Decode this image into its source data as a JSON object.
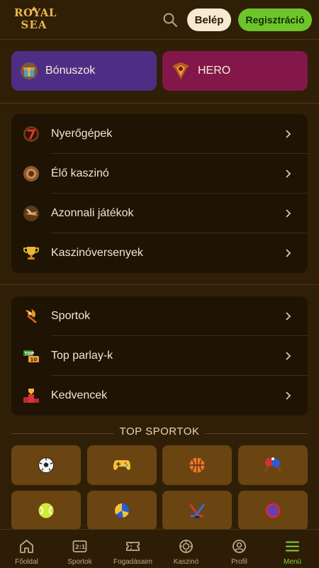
{
  "header": {
    "logo_line1": "ROYAL",
    "logo_line2": "SEA",
    "login_label": "Belép",
    "register_label": "Regisztráció",
    "search_icon": "search-icon"
  },
  "promos": [
    {
      "label": "Bónuszok",
      "icon": "gift-icon",
      "color": "#4e2e84"
    },
    {
      "label": "HERO",
      "icon": "hero-shield-icon",
      "color": "#83174a"
    }
  ],
  "casino_menu": [
    {
      "label": "Nyerőgépek",
      "icon": "slot-seven-icon"
    },
    {
      "label": "Élő kaszinó",
      "icon": "live-casino-chip-icon"
    },
    {
      "label": "Azonnali játékok",
      "icon": "plane-icon"
    },
    {
      "label": "Kaszinóversenyek",
      "icon": "trophy-icon"
    }
  ],
  "sports_menu": [
    {
      "label": "Sportok",
      "icon": "torch-icon"
    },
    {
      "label": "Top parlay-k",
      "icon": "top-10-icon"
    },
    {
      "label": "Kedvencek",
      "icon": "podium-icon"
    }
  ],
  "top_sports": {
    "title": "TOP SPORTOK",
    "items": [
      "football-icon",
      "gamepad-icon",
      "basketball-icon",
      "table-tennis-icon",
      "tennis-icon",
      "volleyball-icon",
      "hockey-icon",
      "mma-glove-icon"
    ]
  },
  "nav": [
    {
      "label": "Főoldal",
      "icon": "home-icon",
      "active": false
    },
    {
      "label": "Sportok",
      "icon": "scoreboard-icon",
      "active": false
    },
    {
      "label": "Fogadásaim",
      "icon": "ticket-icon",
      "active": false
    },
    {
      "label": "Kaszinó",
      "icon": "casino-chip-icon",
      "active": false
    },
    {
      "label": "Profil",
      "icon": "profile-icon",
      "active": false
    },
    {
      "label": "Menü",
      "icon": "menu-icon",
      "active": true
    }
  ],
  "colors": {
    "accent": "#6dc629",
    "active_nav": "#7ed23c",
    "background": "#301f07"
  }
}
